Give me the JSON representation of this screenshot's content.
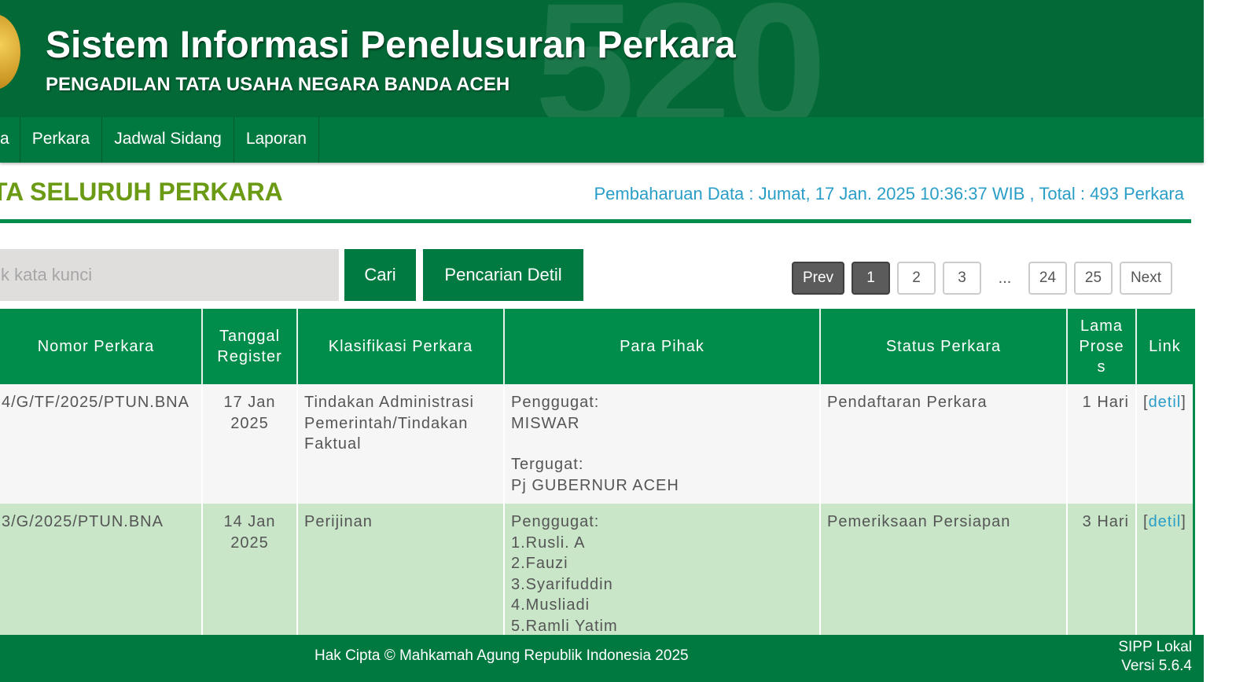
{
  "header": {
    "title": "Sistem Informasi Penelusuran Perkara",
    "subtitle": "PENGADILAN TATA USAHA NEGARA BANDA ACEH",
    "watermark": "520"
  },
  "nav": {
    "items": [
      {
        "label": "a"
      },
      {
        "label": "Perkara"
      },
      {
        "label": "Jadwal Sidang"
      },
      {
        "label": "Laporan"
      }
    ]
  },
  "page": {
    "heading": "TA SELURUH PERKARA",
    "update_info": "Pembaharuan Data : Jumat, 17 Jan. 2025 10:36:37 WIB , Total : 493 Perkara"
  },
  "search": {
    "placeholder": "tik kata kunci",
    "value": "",
    "cari_label": "Cari",
    "detil_label": "Pencarian Detil"
  },
  "pagination": {
    "prev": "Prev",
    "pages": [
      "1",
      "2",
      "3"
    ],
    "ellipsis": "...",
    "last_pages": [
      "24",
      "25"
    ],
    "next": "Next",
    "current": "1"
  },
  "table": {
    "headers": [
      "Nomor Perkara",
      "Tanggal Register",
      "Klasifikasi Perkara",
      "Para Pihak",
      "Status Perkara",
      "Lama Proses",
      "Link"
    ],
    "header_display": {
      "tanggal": [
        "Tanggal",
        "Register"
      ],
      "lama": [
        "Lama",
        "Prose",
        "s"
      ]
    },
    "rows": [
      {
        "nomor": "4/G/TF/2025/PTUN.BNA",
        "tanggal": [
          "17 Jan",
          "2025"
        ],
        "klasifikasi": "Tindakan Administrasi Pemerintah/Tindakan Faktual",
        "penggugat_label": "Penggugat:",
        "penggugat": [
          "MISWAR"
        ],
        "tergugat_label": "Tergugat:",
        "tergugat": [
          "Pj GUBERNUR ACEH"
        ],
        "status": "Pendaftaran Perkara",
        "lama": "1 Hari",
        "link_open": "[",
        "link": "detil",
        "link_close": "]"
      },
      {
        "nomor": "3/G/2025/PTUN.BNA",
        "tanggal": [
          "14 Jan",
          "2025"
        ],
        "klasifikasi": "Perijinan",
        "penggugat_label": "Penggugat:",
        "penggugat": [
          "1.Rusli. A",
          "2.Fauzi",
          "3.Syarifuddin",
          "4.Musliadi",
          "5.Ramli Yatim"
        ],
        "status": "Pemeriksaan Persiapan",
        "lama": "3 Hari",
        "link_open": "[",
        "link": "detil",
        "link_close": "]"
      }
    ]
  },
  "footer": {
    "copyright": "Hak Cipta © Mahkamah Agung Republik Indonesia 2025",
    "app": "SIPP Lokal",
    "version": "Versi 5.6.4"
  },
  "colors": {
    "header_bg": "#036937",
    "nav_bg": "#007940",
    "table_header_bg": "#008c4a",
    "heading_color": "#6b9a14",
    "link_color": "#2a9ec7",
    "row_alt_bg": "#c9e6c9"
  }
}
